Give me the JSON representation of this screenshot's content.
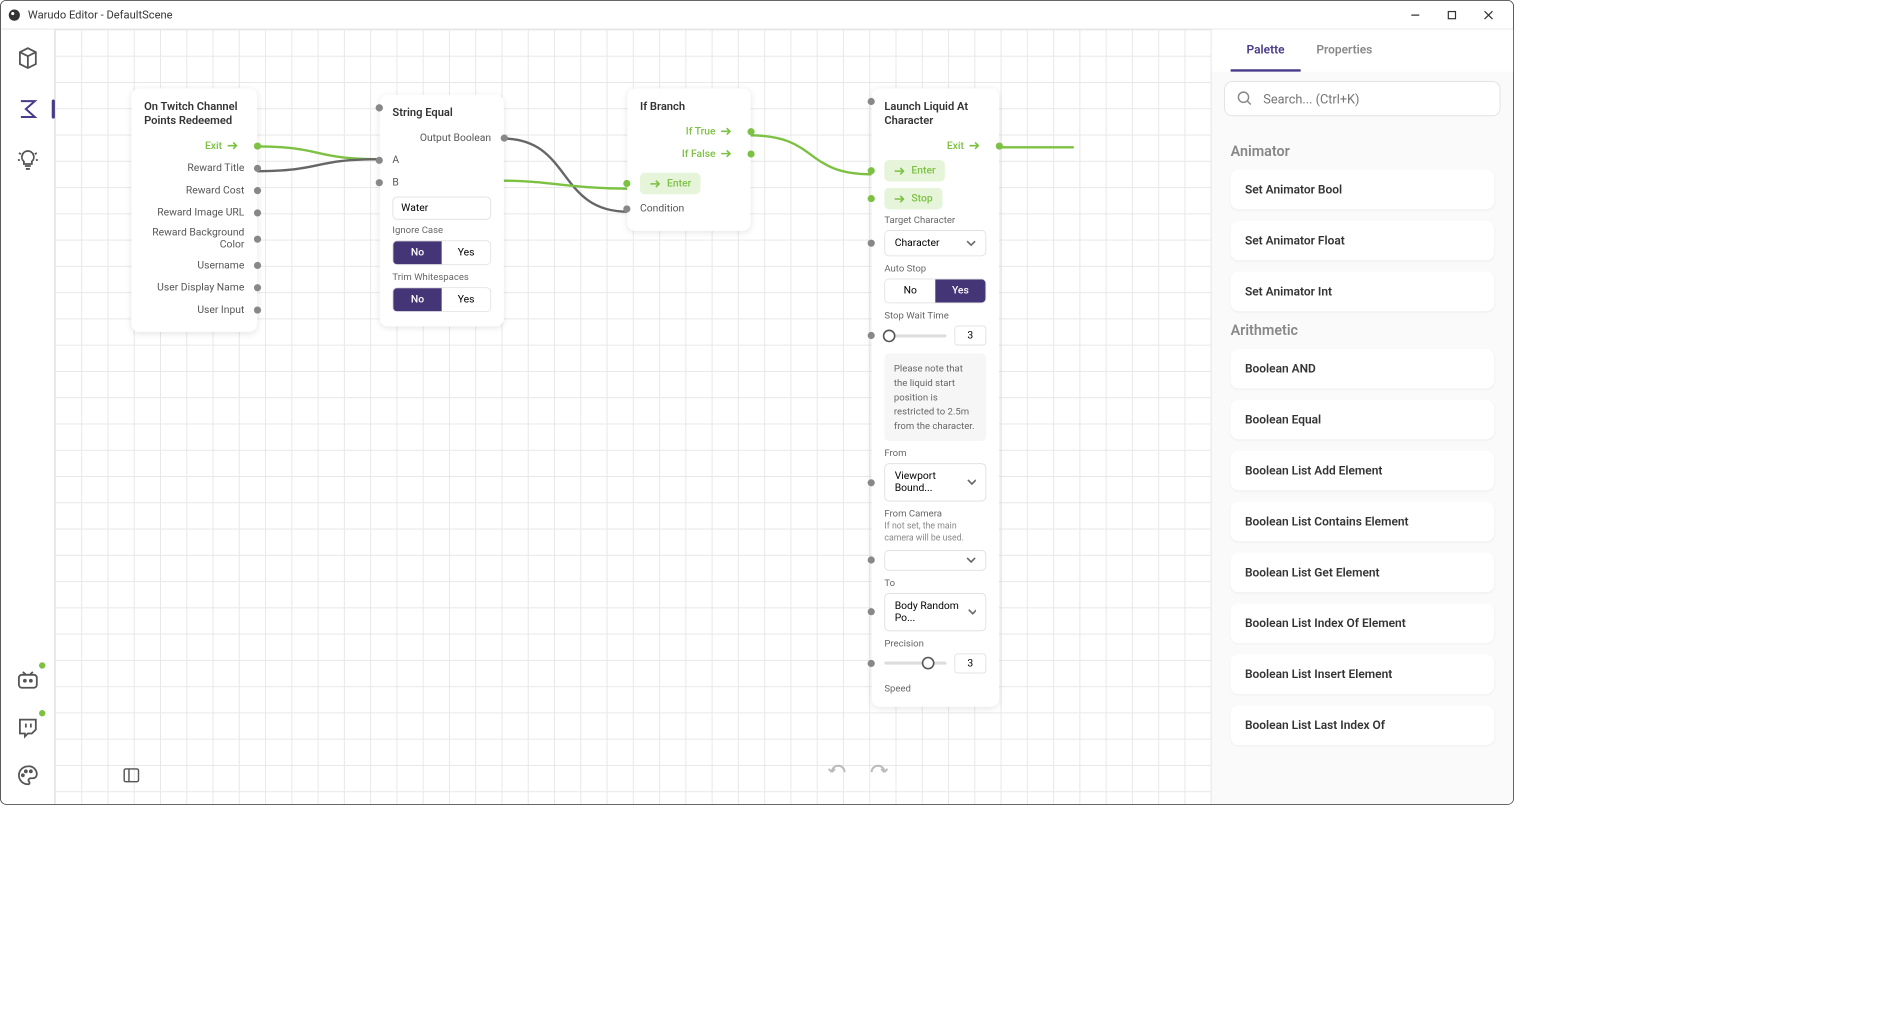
{
  "window": {
    "title": "Warudo Editor - DefaultScene"
  },
  "tabs": {
    "palette": "Palette",
    "properties": "Properties"
  },
  "search": {
    "placeholder": "Search... (Ctrl+K)"
  },
  "palette": {
    "categories": [
      {
        "name": "Animator",
        "items": [
          "Set Animator Bool",
          "Set Animator Float",
          "Set Animator Int"
        ]
      },
      {
        "name": "Arithmetic",
        "items": [
          "Boolean AND",
          "Boolean Equal",
          "Boolean List Add Element",
          "Boolean List Contains Element",
          "Boolean List Get Element",
          "Boolean List Index Of Element",
          "Boolean List Insert Element",
          "Boolean List Last Index Of"
        ]
      }
    ]
  },
  "nodes": {
    "twitch": {
      "title": "On Twitch Channel Points Redeemed",
      "exit": "Exit",
      "outputs": [
        "Reward Title",
        "Reward Cost",
        "Reward Image URL",
        "Reward Background Color",
        "Username",
        "User Display Name",
        "User Input"
      ]
    },
    "stringEqual": {
      "title": "String Equal",
      "outputBool": "Output Boolean",
      "a": "A",
      "b": "B",
      "bValue": "Water",
      "ignoreCase": "Ignore Case",
      "trimWs": "Trim Whitespaces",
      "no": "No",
      "yes": "Yes"
    },
    "ifBranch": {
      "title": "If Branch",
      "ifTrue": "If True",
      "ifFalse": "If False",
      "enter": "Enter",
      "condition": "Condition"
    },
    "launch": {
      "title": "Launch Liquid At Character",
      "exit": "Exit",
      "enter": "Enter",
      "stop": "Stop",
      "targetChar": "Target Character",
      "targetCharVal": "Character",
      "autoStop": "Auto Stop",
      "no": "No",
      "yes": "Yes",
      "stopWait": "Stop Wait Time",
      "stopWaitVal": "3",
      "note": "Please note that the liquid start position is restricted to 2.5m from the character.",
      "from": "From",
      "fromVal": "Viewport Bound...",
      "fromCamera": "From Camera",
      "fromCameraHint": "If not set, the main camera will be used.",
      "to": "To",
      "toVal": "Body Random Po...",
      "precision": "Precision",
      "precisionVal": "3",
      "speed": "Speed"
    }
  }
}
